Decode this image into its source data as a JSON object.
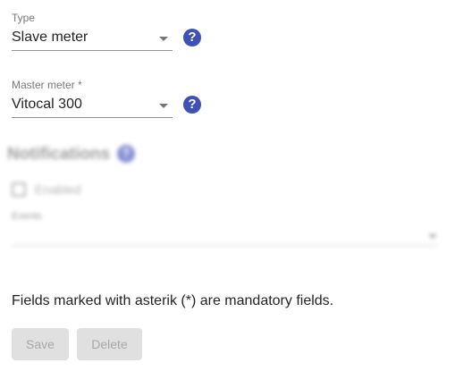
{
  "type_field": {
    "label": "Type",
    "value": "Slave meter"
  },
  "master_field": {
    "label": "Master meter *",
    "value": "Vitocal 300"
  },
  "help_glyph": "?",
  "notifications": {
    "title": "Notifications",
    "enabled_label": "Enabled",
    "events_label": "Events"
  },
  "mandatory_note": "Fields marked with asterik (*) are mandatory fields.",
  "buttons": {
    "save": "Save",
    "delete": "Delete"
  },
  "colors": {
    "accent": "#3f51b5",
    "disabled_bg": "#e0e0e0"
  }
}
